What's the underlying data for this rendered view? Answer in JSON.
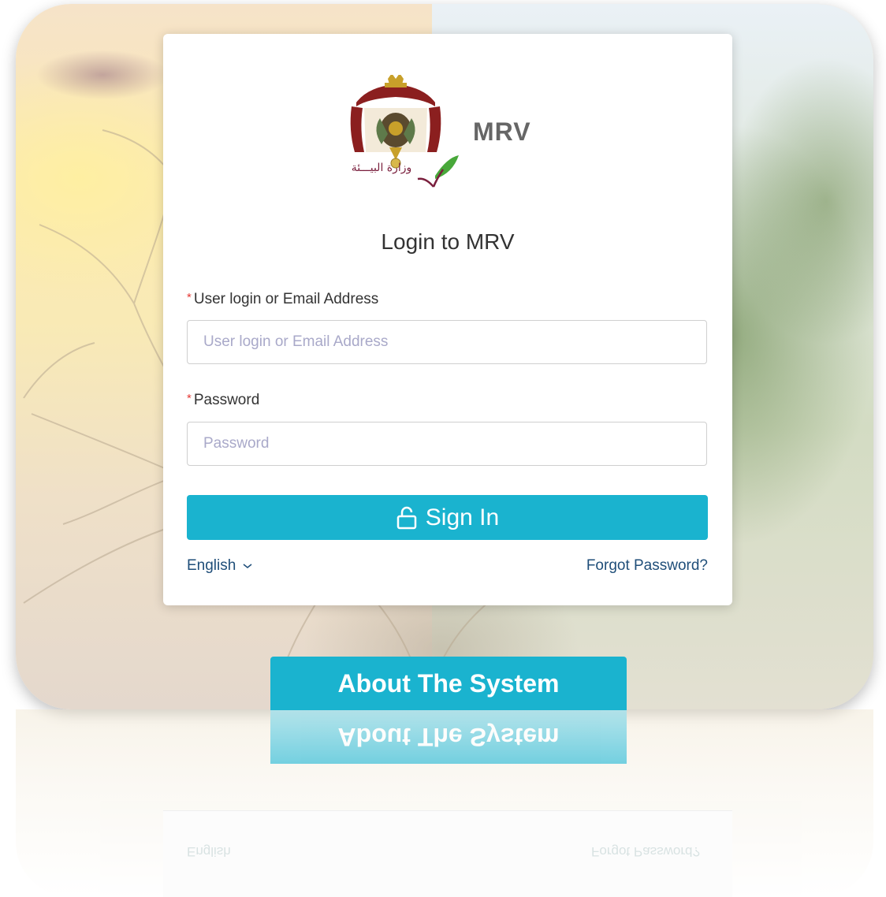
{
  "app": {
    "name": "MRV",
    "logo_text_arabic": "وزارة البيـــئة"
  },
  "login": {
    "title": "Login to MRV",
    "username_label": "User login or Email Address",
    "username_placeholder": "User login or Email Address",
    "username_value": "",
    "password_label": "Password",
    "password_placeholder": "Password",
    "password_value": "",
    "required_marker": "*",
    "signin_label": "Sign In",
    "language": "English",
    "forgot_password": "Forgot Password?"
  },
  "about": {
    "label": "About The System"
  },
  "colors": {
    "accent": "#1ab3cf",
    "link": "#1f4e79",
    "required": "#e53935",
    "app_name": "#666666"
  },
  "icons": {
    "signin": "unlock-icon",
    "language": "chevron-down-icon"
  }
}
